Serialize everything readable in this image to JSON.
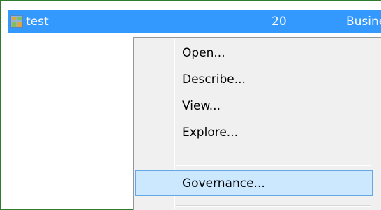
{
  "row": {
    "name": "test",
    "count": "20",
    "type": "Business",
    "icon": "table-icon"
  },
  "menu": {
    "items": [
      {
        "label": "Open..."
      },
      {
        "label": "Describe..."
      },
      {
        "label": "View..."
      },
      {
        "label": "Explore..."
      },
      {
        "label": "Governance..."
      }
    ]
  },
  "colors": {
    "selection": "#3399ff",
    "menu_background": "#f0f0f0",
    "hover_background": "#cce8ff",
    "hover_border": "#66a7e8",
    "frame_border": "#2e7d2e"
  }
}
